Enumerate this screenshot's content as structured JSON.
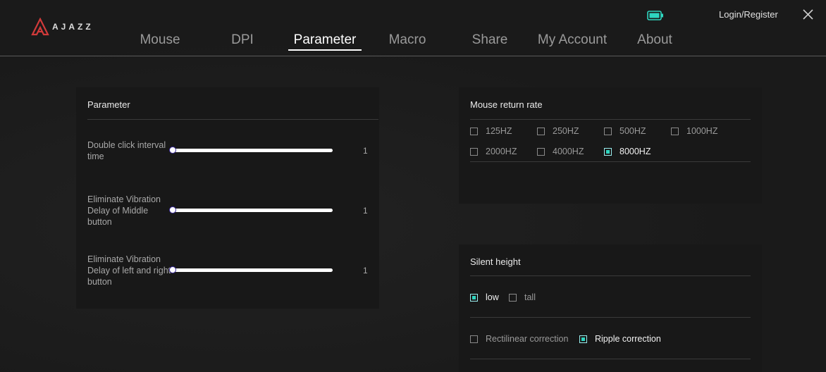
{
  "header": {
    "logo_text": "AJAZZ",
    "login_label": "Login/Register",
    "battery_color": "#2ed6c0"
  },
  "nav": {
    "items": [
      "Mouse",
      "DPI",
      "Parameter",
      "Macro",
      "Share",
      "My Account",
      "About"
    ],
    "active": "Parameter"
  },
  "parameter": {
    "title": "Parameter",
    "sliders": [
      {
        "label": "Double click interval time",
        "value": "1"
      },
      {
        "label": "Eliminate Vibration Delay of Middle button",
        "value": "1"
      },
      {
        "label": "Eliminate Vibration Delay of left and right button",
        "value": "1"
      }
    ]
  },
  "return_rate": {
    "title": "Mouse return rate",
    "options": [
      "125HZ",
      "250HZ",
      "500HZ",
      "1000HZ",
      "2000HZ",
      "4000HZ",
      "8000HZ"
    ],
    "selected": "8000HZ"
  },
  "silent": {
    "title": "Silent height",
    "height_options": [
      "low",
      "tall"
    ],
    "height_selected": "low",
    "correction_options": [
      "Rectilinear correction",
      "Ripple correction"
    ],
    "correction_selected": "Ripple correction"
  },
  "colors": {
    "accent": "#2ed6c0",
    "background": "#1b1b1b",
    "panel": "#181818"
  }
}
